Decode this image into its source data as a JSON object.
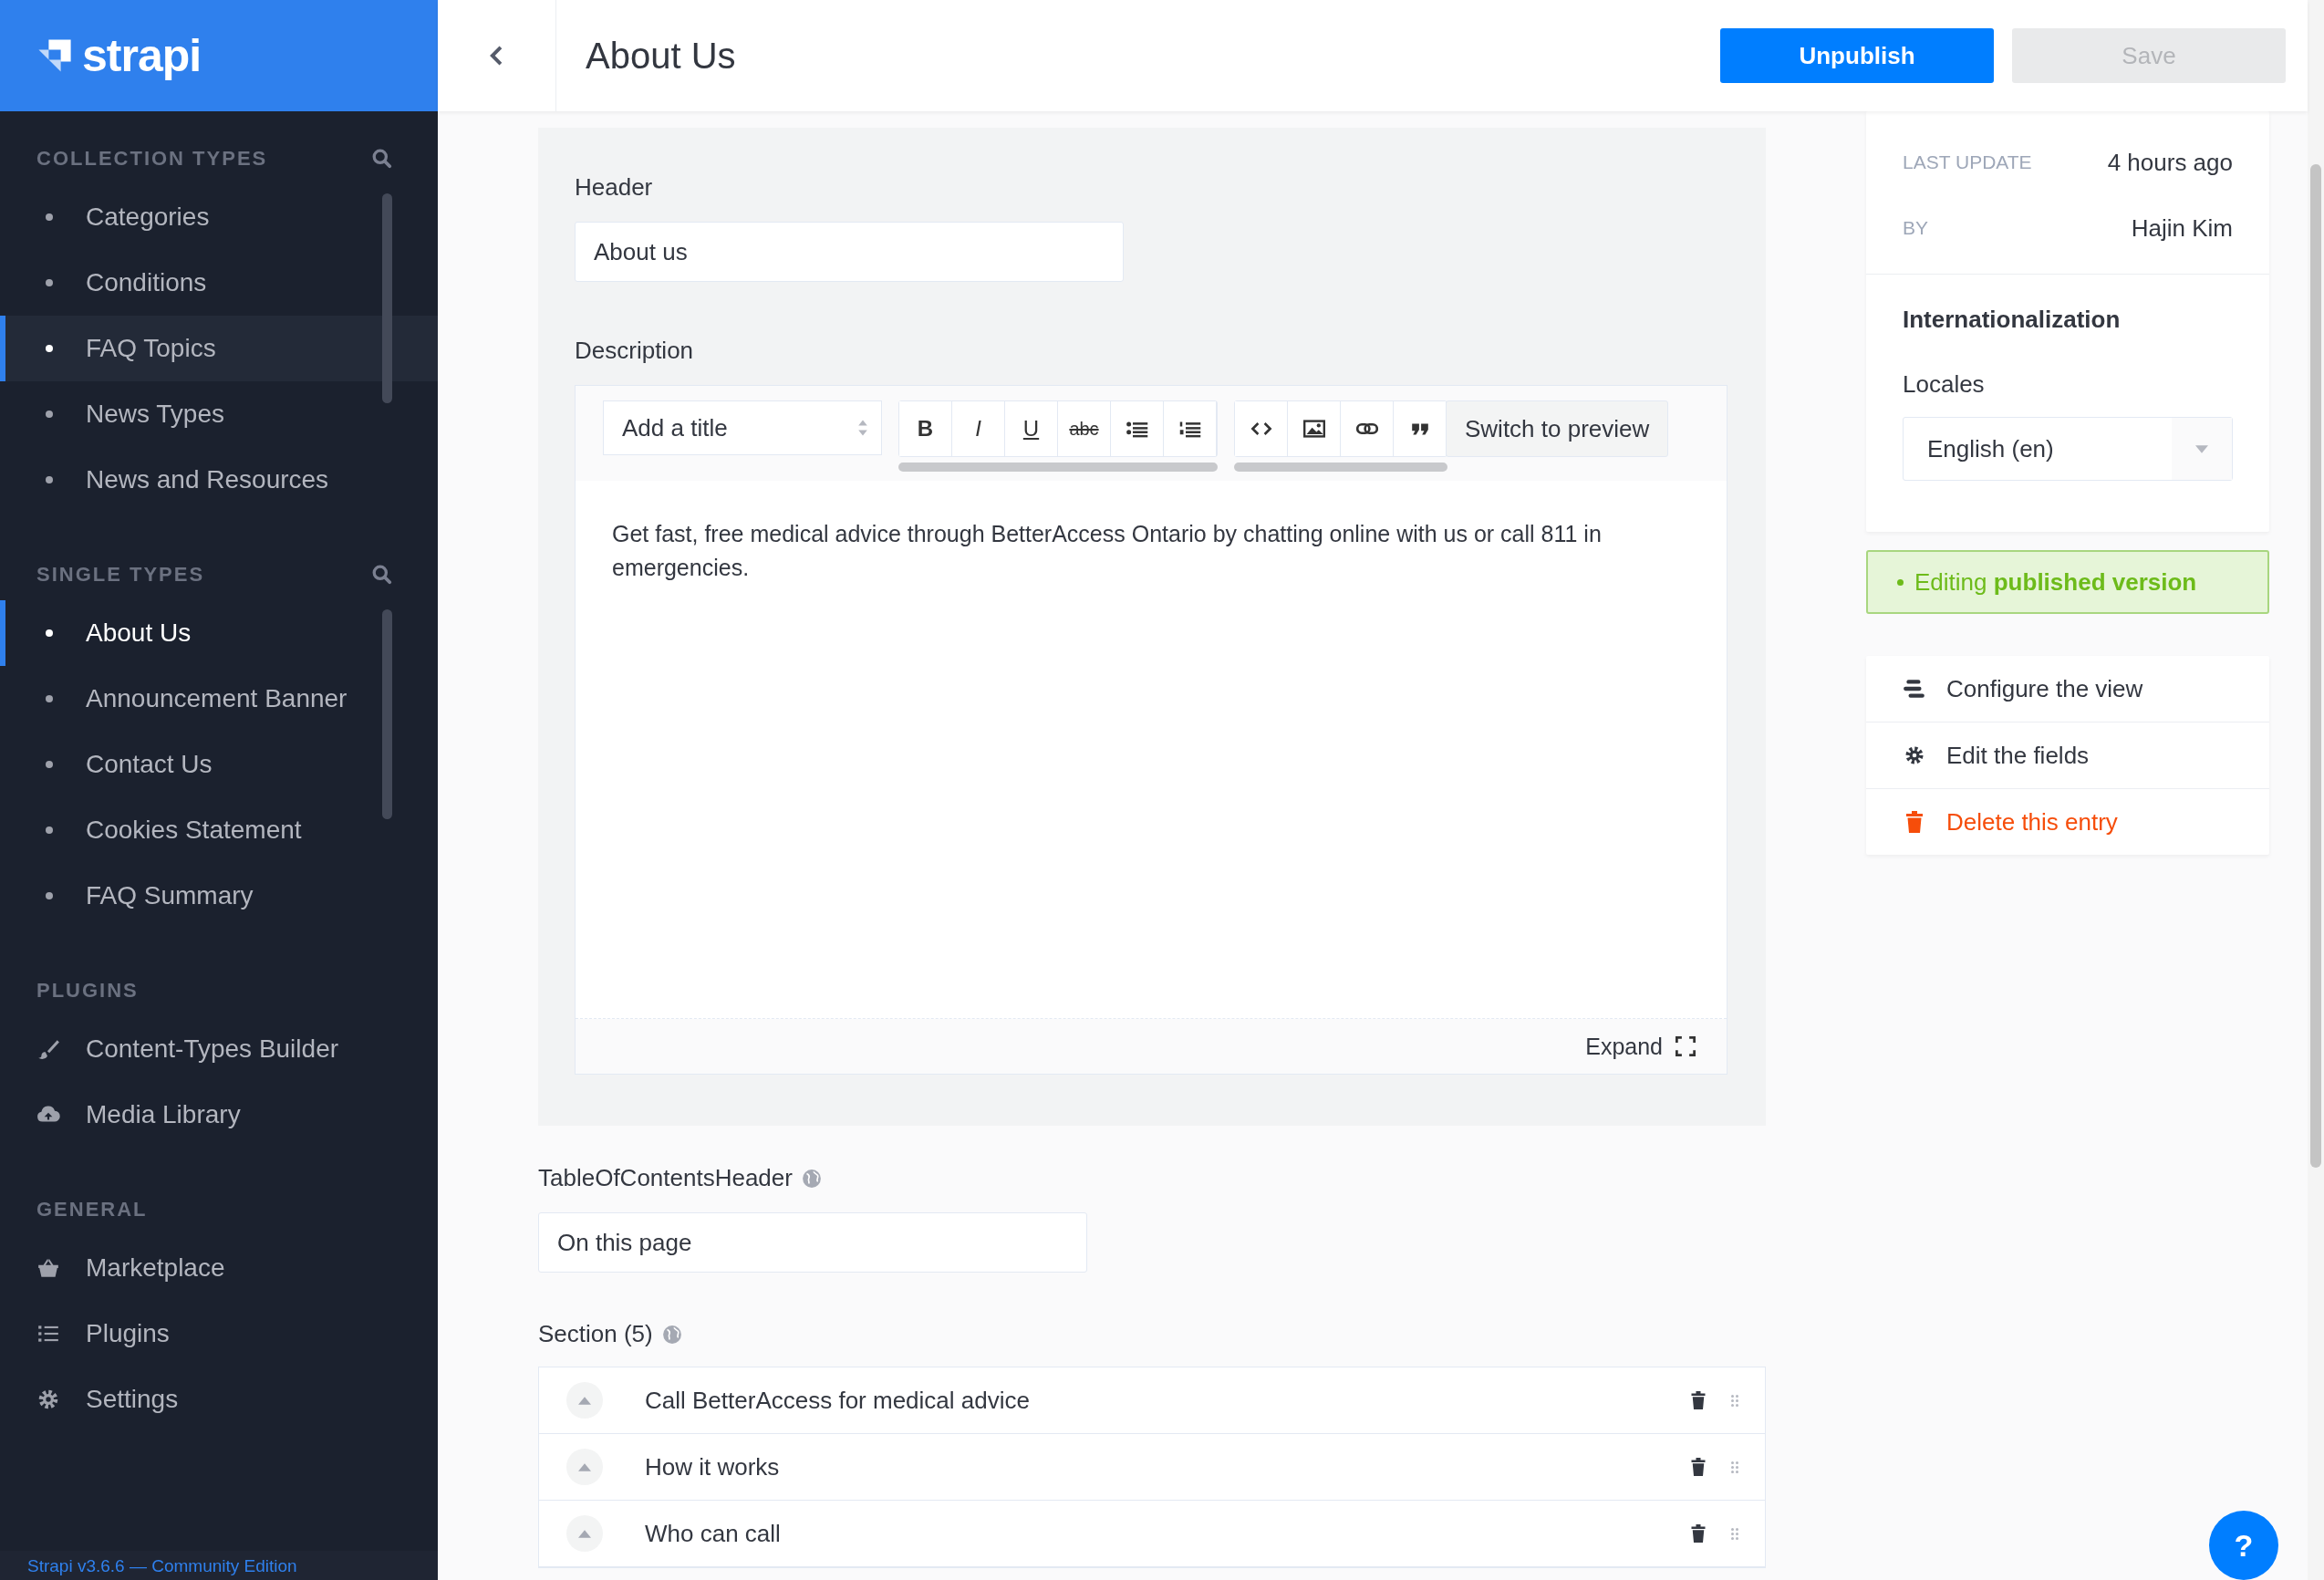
{
  "brand": {
    "name": "strapi"
  },
  "sidebar": {
    "sections": [
      {
        "title": "COLLECTION TYPES",
        "items": [
          {
            "label": "Categories",
            "selected": false,
            "hovered": false
          },
          {
            "label": "Conditions",
            "selected": false,
            "hovered": false
          },
          {
            "label": "FAQ Topics",
            "selected": false,
            "hovered": true
          },
          {
            "label": "News Types",
            "selected": false,
            "hovered": false
          },
          {
            "label": "News and Resources",
            "selected": false,
            "hovered": false
          }
        ]
      },
      {
        "title": "SINGLE TYPES",
        "items": [
          {
            "label": "About Us",
            "selected": true,
            "hovered": false
          },
          {
            "label": "Announcement Banner",
            "selected": false,
            "hovered": false
          },
          {
            "label": "Contact Us",
            "selected": false,
            "hovered": false
          },
          {
            "label": "Cookies Statement",
            "selected": false,
            "hovered": false
          },
          {
            "label": "FAQ Summary",
            "selected": false,
            "hovered": false
          }
        ]
      },
      {
        "title": "PLUGINS",
        "items": [
          {
            "label": "Content-Types Builder",
            "selected": false,
            "hovered": false
          },
          {
            "label": "Media Library",
            "selected": false,
            "hovered": false
          }
        ]
      },
      {
        "title": "GENERAL",
        "items": [
          {
            "label": "Marketplace",
            "selected": false,
            "hovered": false
          },
          {
            "label": "Plugins",
            "selected": false,
            "hovered": false
          },
          {
            "label": "Settings",
            "selected": false,
            "hovered": false
          }
        ]
      }
    ],
    "footer": "Strapi v3.6.6 — Community Edition"
  },
  "header": {
    "title": "About Us",
    "buttons": [
      {
        "label": "Unpublish",
        "disabled": false
      },
      {
        "label": "Save",
        "disabled": true
      }
    ]
  },
  "form": {
    "header_field": {
      "label": "Header",
      "value": "About us"
    },
    "description": {
      "label": "Description",
      "title_select": {
        "placeholder": "Add a title"
      },
      "format_buttons": [
        "B",
        "I",
        "U",
        "abc"
      ],
      "preview_button": "Switch to preview",
      "text": "Get fast, free medical advice through BetterAccess Ontario by chatting online with us or call 811 in emergencies.",
      "expand": "Expand"
    },
    "toc_field": {
      "label": "TableOfContentsHeader",
      "value": "On this page"
    },
    "sections": {
      "label": "Section (5)",
      "rows": [
        {
          "title": "Call BetterAccess for medical advice"
        },
        {
          "title": "How it works"
        },
        {
          "title": "Who can call"
        }
      ]
    }
  },
  "panel": {
    "info": [
      {
        "label": "LAST UPDATE",
        "value": "4 hours ago"
      },
      {
        "label": "BY",
        "value": "Hajin Kim"
      }
    ],
    "i18n": {
      "title": "Internationalization",
      "locales_label": "Locales",
      "locale": "English (en)"
    },
    "status": "Editing **published version**",
    "actions": [
      {
        "label": "Configure the view",
        "kind": "configure"
      },
      {
        "label": "Edit the fields",
        "kind": "fields"
      },
      {
        "label": "Delete this entry",
        "kind": "delete"
      }
    ]
  },
  "help": "?"
}
